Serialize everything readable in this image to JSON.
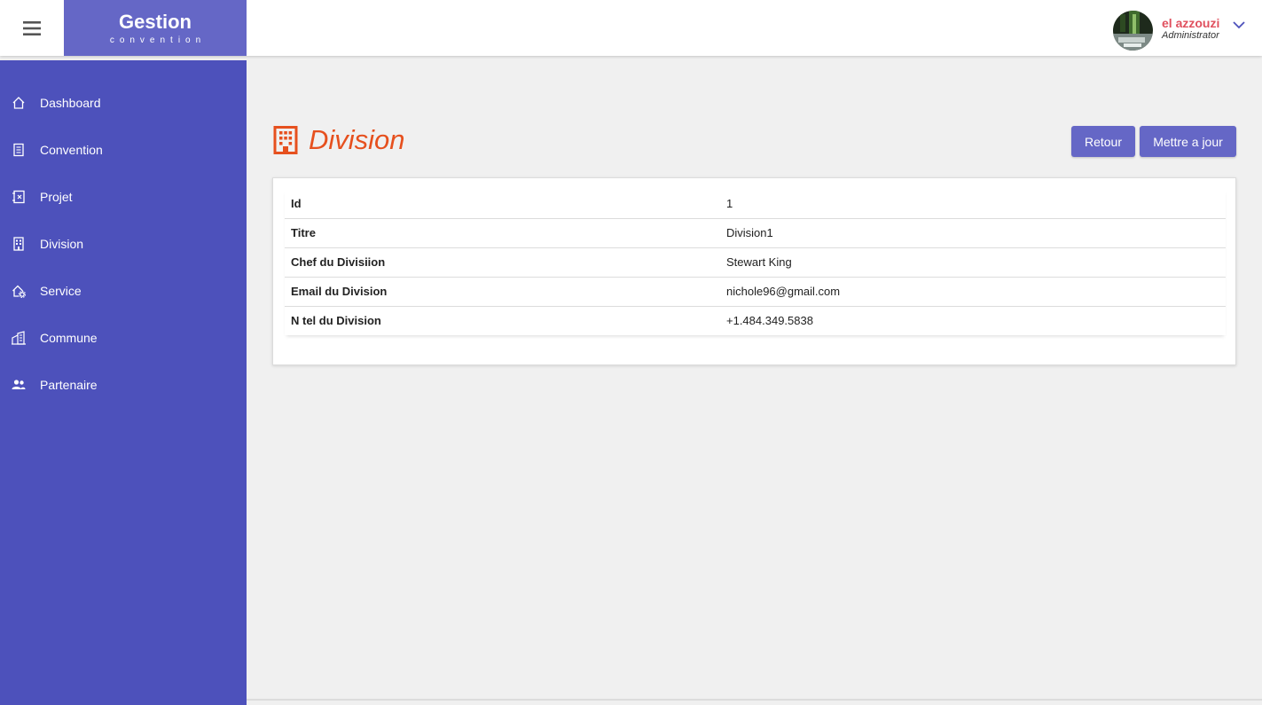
{
  "brand": {
    "title": "Gestion",
    "subtitle": "convention"
  },
  "user": {
    "name": "el azzouzi",
    "role": "Administrator"
  },
  "sidebar": {
    "items": [
      {
        "label": "Dashboard",
        "icon": "home-icon"
      },
      {
        "label": "Convention",
        "icon": "document-icon"
      },
      {
        "label": "Projet",
        "icon": "project-icon"
      },
      {
        "label": "Division",
        "icon": "building-icon"
      },
      {
        "label": "Service",
        "icon": "house-gear-icon"
      },
      {
        "label": "Commune",
        "icon": "city-icon"
      },
      {
        "label": "Partenaire",
        "icon": "people-icon"
      }
    ]
  },
  "page": {
    "title": "Division",
    "title_icon": "building-icon",
    "buttons": {
      "back": "Retour",
      "update": "Mettre a jour"
    }
  },
  "details": {
    "rows": [
      {
        "label": "Id",
        "value": "1"
      },
      {
        "label": "Titre",
        "value": "Division1"
      },
      {
        "label": "Chef du Divisiion",
        "value": "Stewart King"
      },
      {
        "label": "Email du Division",
        "value": "nichole96@gmail.com"
      },
      {
        "label": "N tel du Division",
        "value": "+1.484.349.5838"
      }
    ]
  },
  "colors": {
    "sidebar": "#4d51bb",
    "brand": "#6567c6",
    "accent": "#e6501e",
    "button": "#6567c6",
    "user_name": "#e0505e"
  }
}
